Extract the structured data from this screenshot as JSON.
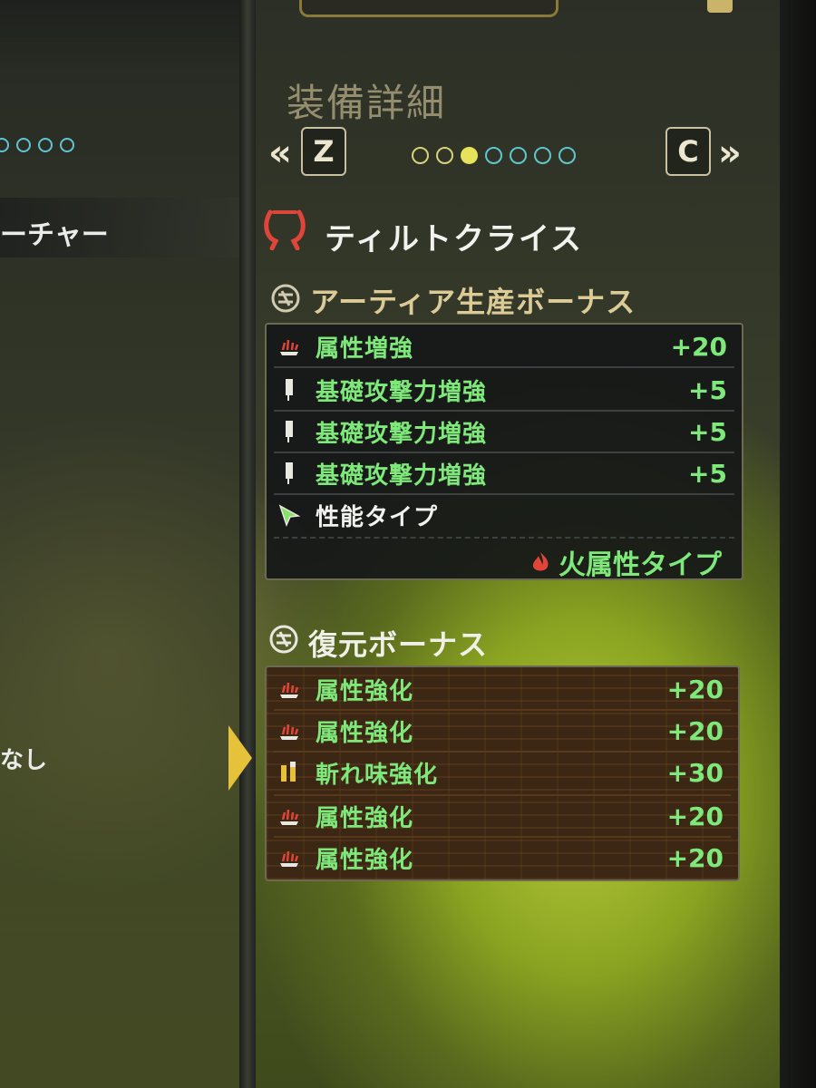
{
  "left_panel": {
    "dots_count": 4,
    "row_label": "ーチャー",
    "lower_label": "なし"
  },
  "header": {
    "title": "装備詳細",
    "prev_button": "Z",
    "next_button": "C",
    "prev_chevron": "«",
    "next_chevron": "»",
    "page_total": 7,
    "page_current": 3
  },
  "weapon": {
    "name": "ティルトクライス",
    "icon": "weapon-hook-icon"
  },
  "artian_bonus": {
    "heading": "アーティア生産ボーナス",
    "rows": [
      {
        "icon": "element-icon",
        "label": "属性増強",
        "value": "+20"
      },
      {
        "icon": "attack-icon",
        "label": "基礎攻撃力増強",
        "value": "+5"
      },
      {
        "icon": "attack-icon",
        "label": "基礎攻撃力増強",
        "value": "+5"
      },
      {
        "icon": "attack-icon",
        "label": "基礎攻撃力増強",
        "value": "+5"
      }
    ],
    "type_label": "性能タイプ",
    "type_value": "火属性タイプ"
  },
  "restore_bonus": {
    "heading": "復元ボーナス",
    "rows": [
      {
        "icon": "element-icon",
        "label": "属性強化",
        "value": "+20"
      },
      {
        "icon": "element-icon",
        "label": "属性強化",
        "value": "+20"
      },
      {
        "icon": "sharpness-icon",
        "label": "斬れ味強化",
        "value": "+30"
      },
      {
        "icon": "element-icon",
        "label": "属性強化",
        "value": "+20"
      },
      {
        "icon": "element-icon",
        "label": "属性強化",
        "value": "+20"
      }
    ]
  },
  "colors": {
    "green_text": "#7ee87a",
    "gold_heading": "#dccb97",
    "fire_red": "#e0453a",
    "dot_active": "#e6e35a",
    "dot_inactive_cyan": "#5fc6cf"
  }
}
